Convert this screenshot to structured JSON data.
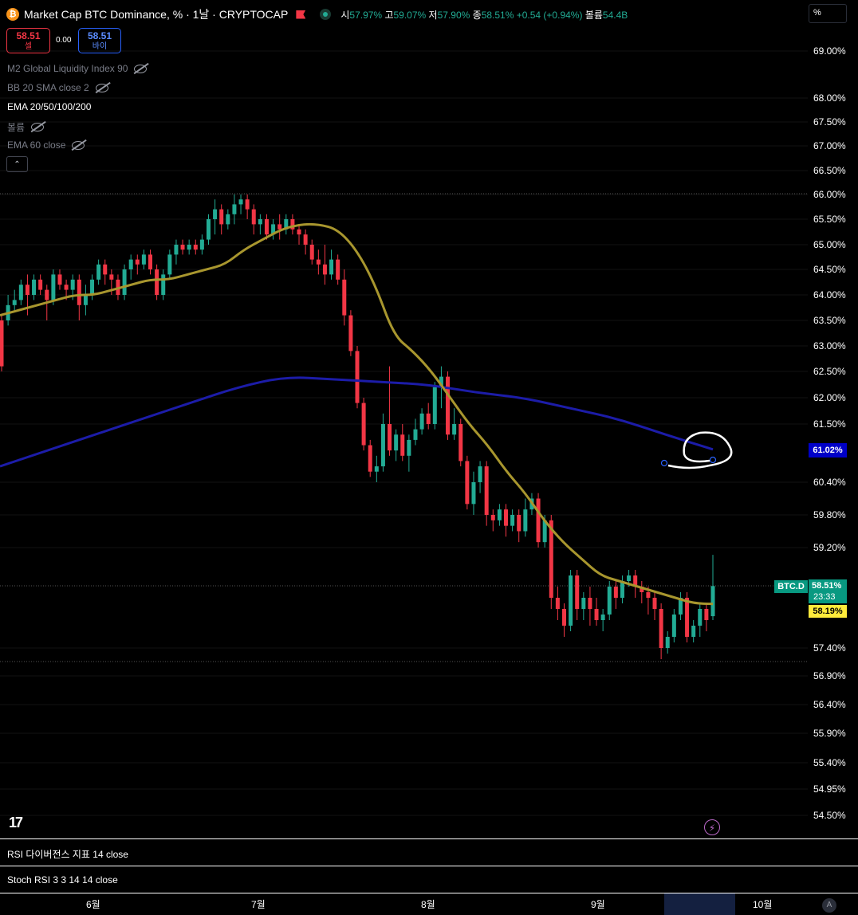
{
  "header": {
    "coin_icon": "bitcoin-icon",
    "coin_glyph": "₿",
    "symbol_title": "Market Cap BTC Dominance, % · 1날 · CRYPTOCAP",
    "ohlc": {
      "open_label": "시",
      "open": "57.97%",
      "high_label": "고",
      "high": "59.07%",
      "low_label": "저",
      "low": "57.90%",
      "close_label": "종",
      "close": "58.51%",
      "change": "+0.54 (+0.94%)",
      "volume_label": "볼륨",
      "volume": "54.4B"
    },
    "scale_mode": "%"
  },
  "trade": {
    "sell_price": "58.51",
    "sell_label": "셀",
    "spread": "0.00",
    "buy_price": "58.51",
    "buy_label": "바이"
  },
  "indicators": [
    {
      "label": "M2 Global Liquidity Index 90",
      "visible": false
    },
    {
      "label": "BB 20 SMA close 2",
      "visible": false
    },
    {
      "label": "EMA 20/50/100/200",
      "visible": true
    },
    {
      "label": "볼륨",
      "visible": false
    },
    {
      "label": "EMA 60 close",
      "visible": false
    }
  ],
  "collapse_glyph": "⌃",
  "price_axis": [
    "69.00%",
    "68.00%",
    "67.50%",
    "67.00%",
    "66.50%",
    "66.00%",
    "65.50%",
    "65.00%",
    "64.50%",
    "64.00%",
    "63.50%",
    "63.00%",
    "62.50%",
    "62.00%",
    "61.50%",
    "60.40%",
    "59.80%",
    "59.20%",
    "57.40%",
    "56.90%",
    "56.40%",
    "55.90%",
    "55.40%",
    "54.95%",
    "54.50%"
  ],
  "price_tags": {
    "blue_ema": "61.02%",
    "symbol_tag": "BTC.D",
    "last_price": "58.51%",
    "countdown": "23:33",
    "yellow_ema": "58.19%"
  },
  "panes": {
    "rsi": "RSI 다이버전스 지표 14 close",
    "stoch": "Stoch RSI 3 3 14 14 close"
  },
  "time_axis": [
    "6월",
    "7월",
    "8월",
    "9월",
    "10월"
  ],
  "auto_scale": "A",
  "logo": "17",
  "colors": {
    "up": "#22ab94",
    "down": "#f23645",
    "ema_short": "#a8962e",
    "ema_long": "#1c1ca8",
    "background": "#000000"
  },
  "chart_data": {
    "type": "candlestick",
    "y_unit": "%",
    "x_months": [
      "6월",
      "7월",
      "8월",
      "9월",
      "10월"
    ],
    "last": {
      "open": 57.97,
      "high": 59.07,
      "low": 57.9,
      "close": 58.51
    },
    "ema_short_last": 58.19,
    "ema_long_last": 61.02,
    "candles": [
      [
        63.5,
        62.6,
        63.6,
        62.5
      ],
      [
        63.5,
        63.8,
        64.0,
        63.4
      ],
      [
        63.8,
        63.9,
        64.1,
        63.7
      ],
      [
        63.9,
        64.2,
        64.3,
        63.8
      ],
      [
        64.2,
        64.0,
        64.4,
        63.6
      ],
      [
        64.0,
        64.3,
        64.4,
        63.9
      ],
      [
        64.3,
        64.1,
        64.4,
        64.0
      ],
      [
        64.1,
        63.9,
        64.2,
        63.5
      ],
      [
        63.9,
        64.4,
        64.5,
        63.8
      ],
      [
        64.4,
        64.2,
        64.5,
        64.1
      ],
      [
        64.2,
        64.1,
        64.3,
        63.9
      ],
      [
        64.1,
        64.3,
        64.4,
        63.9
      ],
      [
        64.3,
        63.8,
        64.4,
        63.5
      ],
      [
        63.8,
        64.0,
        64.2,
        63.6
      ],
      [
        64.0,
        64.3,
        64.4,
        63.9
      ],
      [
        64.3,
        64.6,
        64.7,
        64.2
      ],
      [
        64.6,
        64.4,
        64.7,
        64.2
      ],
      [
        64.4,
        64.3,
        64.5,
        64.0
      ],
      [
        64.3,
        64.0,
        64.4,
        63.9
      ],
      [
        64.0,
        64.5,
        64.6,
        63.9
      ],
      [
        64.5,
        64.7,
        64.8,
        64.3
      ],
      [
        64.7,
        64.6,
        64.8,
        64.4
      ],
      [
        64.6,
        64.8,
        64.9,
        64.5
      ],
      [
        64.8,
        64.5,
        64.9,
        64.4
      ],
      [
        64.5,
        64.0,
        64.6,
        63.9
      ],
      [
        64.0,
        64.4,
        64.5,
        63.9
      ],
      [
        64.4,
        64.8,
        64.9,
        64.3
      ],
      [
        64.8,
        65.0,
        65.1,
        64.6
      ],
      [
        65.0,
        64.9,
        65.1,
        64.8
      ],
      [
        64.9,
        65.0,
        65.1,
        64.8
      ],
      [
        65.0,
        64.9,
        65.1,
        64.8
      ],
      [
        64.9,
        65.1,
        65.2,
        64.8
      ],
      [
        65.1,
        65.5,
        65.6,
        65.0
      ],
      [
        65.5,
        65.7,
        65.9,
        65.2
      ],
      [
        65.7,
        65.4,
        65.8,
        65.2
      ],
      [
        65.4,
        65.6,
        65.7,
        65.3
      ],
      [
        65.6,
        65.8,
        66.0,
        65.4
      ],
      [
        65.8,
        65.9,
        66.0,
        65.6
      ],
      [
        65.9,
        65.7,
        66.0,
        65.5
      ],
      [
        65.7,
        65.4,
        65.8,
        65.2
      ],
      [
        65.4,
        65.5,
        65.6,
        65.2
      ],
      [
        65.5,
        65.2,
        65.6,
        65.1
      ],
      [
        65.2,
        65.4,
        65.5,
        65.1
      ],
      [
        65.4,
        65.3,
        65.6,
        65.1
      ],
      [
        65.3,
        65.5,
        65.6,
        65.2
      ],
      [
        65.5,
        65.3,
        65.6,
        65.2
      ],
      [
        65.3,
        65.2,
        65.4,
        65.0
      ],
      [
        65.2,
        65.0,
        65.3,
        64.8
      ],
      [
        65.0,
        64.7,
        65.1,
        64.6
      ],
      [
        64.7,
        64.6,
        64.9,
        64.4
      ],
      [
        64.6,
        64.4,
        65.0,
        64.2
      ],
      [
        64.4,
        64.7,
        64.9,
        64.3
      ],
      [
        64.7,
        64.3,
        64.8,
        64.2
      ],
      [
        64.3,
        63.6,
        64.5,
        63.4
      ],
      [
        63.6,
        62.9,
        63.7,
        62.8
      ],
      [
        62.9,
        61.9,
        63.0,
        61.8
      ],
      [
        61.9,
        61.1,
        62.0,
        61.0
      ],
      [
        61.1,
        60.6,
        61.2,
        60.5
      ],
      [
        60.6,
        60.7,
        60.9,
        60.4
      ],
      [
        60.7,
        61.5,
        61.7,
        60.6
      ],
      [
        61.5,
        61.0,
        62.6,
        60.9
      ],
      [
        61.0,
        61.3,
        61.4,
        60.8
      ],
      [
        61.3,
        60.9,
        61.5,
        60.8
      ],
      [
        60.9,
        61.2,
        61.3,
        60.6
      ],
      [
        61.2,
        61.4,
        61.6,
        61.1
      ],
      [
        61.4,
        61.7,
        61.8,
        61.3
      ],
      [
        61.7,
        61.5,
        61.9,
        61.4
      ],
      [
        61.5,
        62.2,
        62.3,
        61.4
      ],
      [
        62.2,
        62.4,
        62.6,
        61.8
      ],
      [
        62.4,
        61.3,
        62.5,
        61.2
      ],
      [
        61.3,
        61.5,
        61.8,
        61.2
      ],
      [
        61.5,
        60.8,
        61.6,
        60.7
      ],
      [
        60.8,
        60.0,
        60.9,
        59.9
      ],
      [
        60.0,
        60.4,
        60.6,
        59.8
      ],
      [
        60.4,
        60.7,
        60.8,
        60.2
      ],
      [
        60.7,
        59.8,
        60.8,
        59.6
      ],
      [
        59.8,
        59.7,
        59.9,
        59.5
      ],
      [
        59.7,
        59.9,
        60.0,
        59.6
      ],
      [
        59.9,
        59.6,
        60.0,
        59.4
      ],
      [
        59.6,
        59.8,
        59.9,
        59.5
      ],
      [
        59.8,
        59.5,
        59.9,
        59.3
      ],
      [
        59.5,
        59.9,
        60.1,
        59.4
      ],
      [
        59.9,
        60.1,
        60.2,
        59.8
      ],
      [
        60.1,
        59.3,
        60.2,
        59.2
      ],
      [
        59.3,
        59.7,
        59.8,
        59.2
      ],
      [
        59.7,
        58.3,
        59.8,
        58.1
      ],
      [
        58.3,
        58.1,
        58.5,
        57.9
      ],
      [
        58.1,
        57.8,
        58.2,
        57.6
      ],
      [
        57.8,
        58.7,
        58.8,
        57.7
      ],
      [
        58.7,
        58.1,
        58.8,
        57.9
      ],
      [
        58.1,
        58.3,
        58.4,
        57.9
      ],
      [
        58.3,
        58.1,
        58.5,
        57.8
      ],
      [
        58.1,
        57.9,
        58.3,
        57.8
      ],
      [
        57.9,
        58.0,
        58.1,
        57.7
      ],
      [
        58.0,
        58.5,
        58.6,
        57.9
      ],
      [
        58.5,
        58.3,
        58.6,
        58.1
      ],
      [
        58.3,
        58.6,
        58.7,
        58.2
      ],
      [
        58.6,
        58.7,
        58.8,
        58.5
      ],
      [
        58.7,
        58.5,
        58.8,
        58.3
      ],
      [
        58.5,
        58.4,
        58.6,
        58.2
      ],
      [
        58.4,
        58.3,
        58.5,
        58.0
      ],
      [
        58.3,
        58.1,
        58.4,
        57.9
      ],
      [
        58.1,
        57.4,
        58.2,
        57.2
      ],
      [
        57.4,
        57.6,
        57.7,
        57.3
      ],
      [
        57.6,
        58.0,
        58.1,
        57.5
      ],
      [
        58.0,
        58.3,
        58.4,
        57.9
      ],
      [
        58.3,
        57.6,
        58.4,
        57.5
      ],
      [
        57.6,
        57.8,
        57.9,
        57.5
      ],
      [
        57.8,
        58.1,
        58.2,
        57.6
      ],
      [
        58.1,
        57.9,
        58.2,
        57.7
      ],
      [
        57.97,
        58.51,
        59.07,
        57.9
      ]
    ],
    "ema_short": [
      63.6,
      63.7,
      63.8,
      63.9,
      64.0,
      64.0,
      64.1,
      64.2,
      64.3,
      64.3,
      64.4,
      64.5,
      64.6,
      64.9,
      65.1,
      65.3,
      65.4,
      65.4,
      65.3,
      64.9,
      64.2,
      63.2,
      62.9,
      62.5,
      62.0,
      61.5,
      61.1,
      60.6,
      60.2,
      59.7,
      59.3,
      59.0,
      58.7,
      58.6,
      58.5,
      58.4,
      58.3,
      58.2,
      58.19
    ],
    "ema_long": [
      60.7,
      61.0,
      61.3,
      61.6,
      61.9,
      62.2,
      62.4,
      62.35,
      62.3,
      62.25,
      62.1,
      62.0,
      61.8,
      61.6,
      61.3,
      61.02
    ]
  }
}
